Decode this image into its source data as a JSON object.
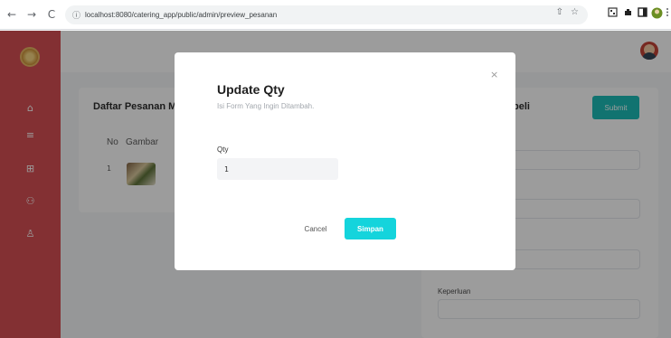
{
  "browser": {
    "url": "localhost:8080/catering_app/public/admin/preview_pesanan",
    "back": "←",
    "forward": "→",
    "reload": "C",
    "info_icon": "ⓘ",
    "share_icon": "⇧",
    "star_icon": "☆"
  },
  "main": {
    "card_title": "Daftar Pesanan M",
    "table_headers": [
      "No",
      "Gambar"
    ],
    "rows": [
      {
        "no": "1"
      }
    ],
    "right_title": "beli",
    "submit_label": "Submit",
    "field_label": "Keperluan"
  },
  "modal": {
    "title": "Update Qty",
    "subtitle": "Isi Form Yang Ingin Ditambah.",
    "qty_label": "Qty",
    "qty_value": "1",
    "cancel_label": "Cancel",
    "save_label": "Simpan",
    "close_icon": "×"
  },
  "sidebar": {
    "icons": [
      "home-icon",
      "list-icon",
      "product-icon",
      "users-icon",
      "user-icon"
    ],
    "glyphs": [
      "⌂",
      "≡",
      "⊞",
      "⚇",
      "♙"
    ]
  },
  "colors": {
    "sidebar": "#d4464a",
    "accent": "#14d4dc",
    "submit": "#11b8b3"
  }
}
